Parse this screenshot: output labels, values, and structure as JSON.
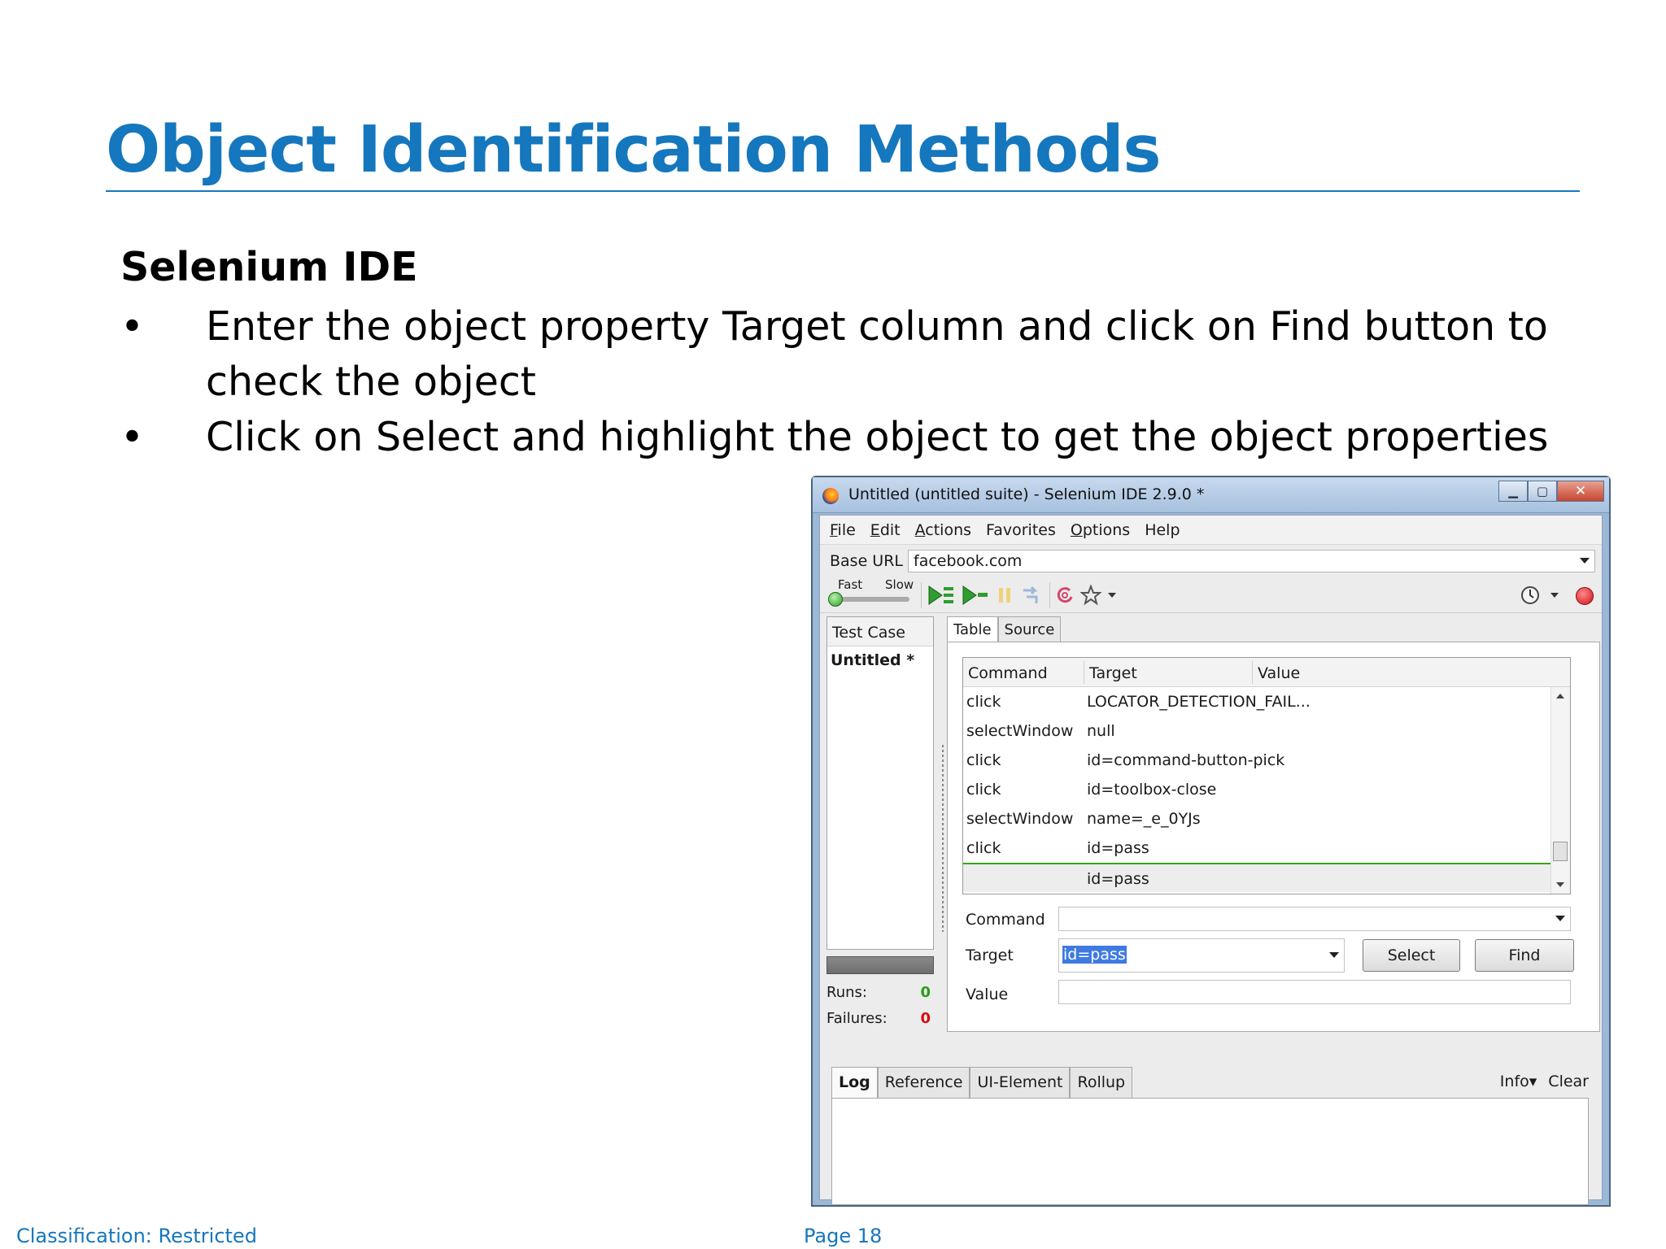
{
  "slide": {
    "title": "Object Identification Methods",
    "subheading": "Selenium IDE",
    "bullets": [
      "Enter the object property Target column and click on Find button to check the object",
      "Click on Select and highlight the object to get the object properties"
    ],
    "bullet_char": "•",
    "footer_left": "Classification: Restricted",
    "footer_center": "Page 18",
    "accent_color": "#1577bd"
  },
  "window": {
    "title": "Untitled (untitled suite) - Selenium IDE 2.9.0 *",
    "icon": "firefox-icon",
    "controls": {
      "minimize": "▁",
      "maximize": "▢",
      "close": "✕"
    },
    "menu": [
      {
        "label": "File",
        "underline": "F",
        "rest": "ile"
      },
      {
        "label": "Edit",
        "underline": "E",
        "rest": "dit"
      },
      {
        "label": "Actions",
        "underline": "A",
        "rest": "ctions"
      },
      {
        "label": "Favorites",
        "underline": "",
        "rest": "Favorites"
      },
      {
        "label": "Options",
        "underline": "O",
        "rest": "ptions"
      },
      {
        "label": "Help",
        "underline": "",
        "rest": "Help"
      }
    ],
    "base_url_label": "Base URL",
    "base_url_value": "facebook.com",
    "speed": {
      "fast": "Fast",
      "slow": "Slow"
    },
    "test_case_header": "Test Case",
    "test_case_item": "Untitled *",
    "runs_label": "Runs:",
    "runs_value": "0",
    "runs_color": "#2a9d1a",
    "failures_label": "Failures:",
    "failures_value": "0",
    "failures_color": "#d01010",
    "tabs": [
      "Table",
      "Source"
    ],
    "table": {
      "headers": [
        "Command",
        "Target",
        "Value"
      ],
      "rows": [
        {
          "command": "click",
          "target": "LOCATOR_DETECTION_FAIL...",
          "value": ""
        },
        {
          "command": "selectWindow",
          "target": "null",
          "value": ""
        },
        {
          "command": "click",
          "target": "id=command-button-pick",
          "value": ""
        },
        {
          "command": "click",
          "target": "id=toolbox-close",
          "value": ""
        },
        {
          "command": "selectWindow",
          "target": "name=_e_0YJs",
          "value": ""
        },
        {
          "command": "click",
          "target": "id=pass",
          "value": ""
        },
        {
          "command": "",
          "target": "id=pass",
          "value": ""
        }
      ]
    },
    "editor": {
      "command_label": "Command",
      "command_value": "",
      "target_label": "Target",
      "target_value": "id=pass",
      "value_label": "Value",
      "value_value": "",
      "select_button": "Select",
      "find_button": "Find"
    },
    "log_tabs": [
      "Log",
      "Reference",
      "UI-Element",
      "Rollup"
    ],
    "log_info": "Info▾",
    "log_clear": "Clear"
  }
}
